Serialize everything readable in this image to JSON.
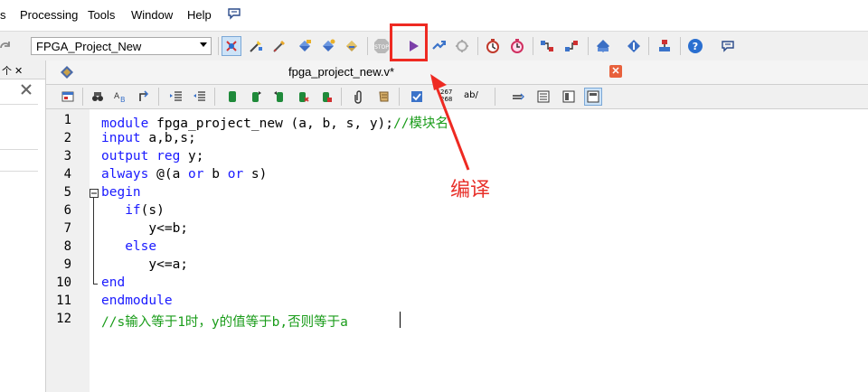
{
  "menus": [
    {
      "label": "s"
    },
    {
      "label": "Processing"
    },
    {
      "label": "Tools"
    },
    {
      "label": "Window"
    },
    {
      "label": "Help"
    }
  ],
  "toolbar": {
    "project_selector_value": "FPGA_Project_New"
  },
  "left_panel": {
    "dock_label": "个 ✕"
  },
  "editor": {
    "tab_title": "fpga_project_new.v*",
    "tab_close": "✕",
    "toolbar_badge": "267\n268",
    "toolbar_ab": "ab/",
    "lines": [
      {
        "num": "1",
        "text": "module fpga_project_new (a, b, s, y);//模块名"
      },
      {
        "num": "2",
        "text": "input a,b,s;"
      },
      {
        "num": "3",
        "text": "output reg y;"
      },
      {
        "num": "4",
        "text": "always @(a or b or s)"
      },
      {
        "num": "5",
        "text": "begin"
      },
      {
        "num": "6",
        "text": "   if(s)"
      },
      {
        "num": "7",
        "text": "      y<=b;"
      },
      {
        "num": "8",
        "text": "   else"
      },
      {
        "num": "9",
        "text": "      y<=a;"
      },
      {
        "num": "10",
        "text": "end"
      },
      {
        "num": "11",
        "text": "endmodule"
      },
      {
        "num": "12",
        "text": "//s输入等于1时，y的值等于b,否则等于a"
      }
    ]
  },
  "annotation": {
    "label": "编译"
  },
  "colors": {
    "keyword": "#1a1aff",
    "comment": "#1a9c1a",
    "annotation": "#ee2a22"
  }
}
